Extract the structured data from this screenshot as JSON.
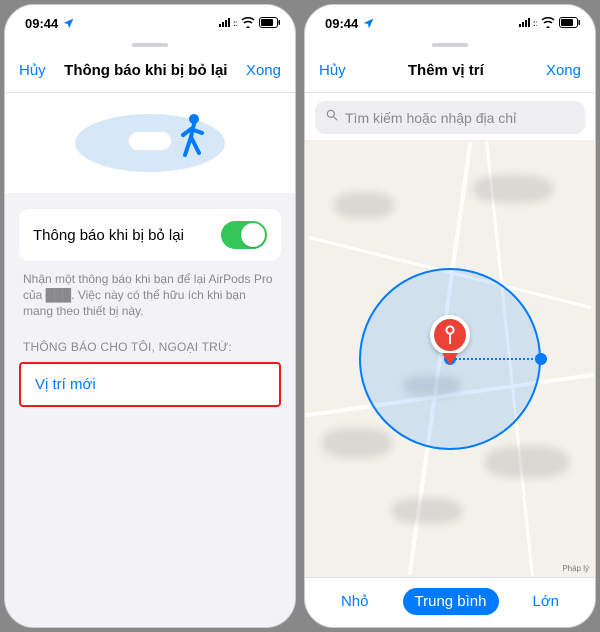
{
  "status": {
    "time": "09:44",
    "signal_icon": "signal-icon",
    "wifi_icon": "wifi-icon",
    "battery_icon": "battery-icon"
  },
  "left": {
    "nav": {
      "cancel": "Hủy",
      "title": "Thông báo khi bị bỏ lại",
      "done": "Xong"
    },
    "toggle": {
      "label": "Thông báo khi bị bỏ lại",
      "on": true
    },
    "description": "Nhận một thông báo khi bạn để lại AirPods Pro của ███. Việc này có thể hữu ích khi bạn mang theo thiết bị này.",
    "section_header": "THÔNG BÁO CHO TÔI, NGOẠI TRỪ:",
    "new_location": "Vị trí mới"
  },
  "right": {
    "nav": {
      "cancel": "Hủy",
      "title": "Thêm vị trí",
      "done": "Xong"
    },
    "search_placeholder": "Tìm kiếm hoặc nhập địa chỉ",
    "attribution": "Pháp lý",
    "radius_options": {
      "small": "Nhỏ",
      "medium": "Trung bình",
      "large": "Lớn"
    },
    "radius_selected": "medium"
  }
}
